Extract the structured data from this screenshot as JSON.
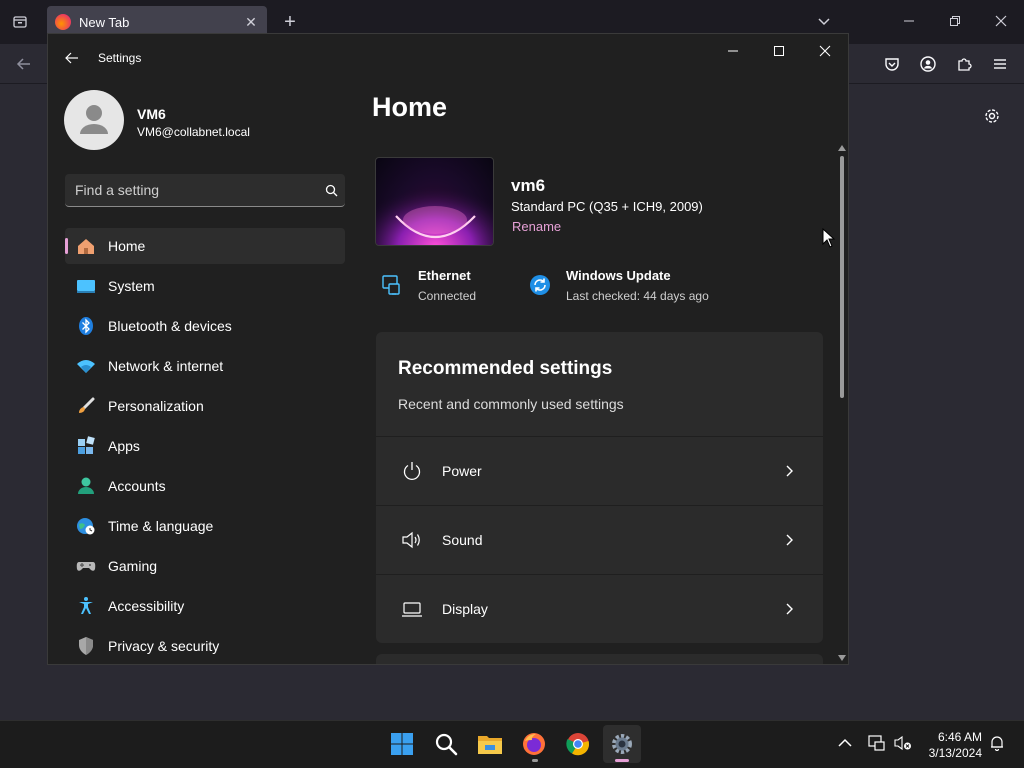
{
  "browser": {
    "tab_title": "New Tab",
    "new_tab_symbol": "+"
  },
  "settings": {
    "window_title": "Settings",
    "profile": {
      "name": "VM6",
      "email": "VM6@collabnet.local"
    },
    "search_placeholder": "Find a setting",
    "nav": [
      {
        "label": "Home",
        "icon": "home-icon",
        "active": true
      },
      {
        "label": "System",
        "icon": "system-icon"
      },
      {
        "label": "Bluetooth & devices",
        "icon": "bluetooth-icon"
      },
      {
        "label": "Network & internet",
        "icon": "wifi-icon"
      },
      {
        "label": "Personalization",
        "icon": "brush-icon"
      },
      {
        "label": "Apps",
        "icon": "apps-icon"
      },
      {
        "label": "Accounts",
        "icon": "account-icon"
      },
      {
        "label": "Time & language",
        "icon": "globe-clock-icon"
      },
      {
        "label": "Gaming",
        "icon": "gamepad-icon"
      },
      {
        "label": "Accessibility",
        "icon": "accessibility-icon"
      },
      {
        "label": "Privacy & security",
        "icon": "shield-icon"
      }
    ],
    "page_title": "Home",
    "device": {
      "name": "vm6",
      "model": "Standard PC (Q35 + ICH9, 2009)",
      "rename_label": "Rename"
    },
    "status": [
      {
        "title": "Ethernet",
        "subtitle": "Connected",
        "icon": "ethernet-icon"
      },
      {
        "title": "Windows Update",
        "subtitle": "Last checked: 44 days ago",
        "icon": "windows-update-icon"
      }
    ],
    "recommended": {
      "title": "Recommended settings",
      "subtitle": "Recent and commonly used settings",
      "items": [
        {
          "label": "Power",
          "icon": "power-icon"
        },
        {
          "label": "Sound",
          "icon": "speaker-icon"
        },
        {
          "label": "Display",
          "icon": "display-icon"
        }
      ]
    }
  },
  "taskbar": {
    "time": "6:46 AM",
    "date": "3/13/2024",
    "apps": [
      "start-icon",
      "search-icon",
      "file-explorer-icon",
      "firefox-icon",
      "chrome-icon",
      "settings-icon"
    ]
  },
  "colors": {
    "accent": "#e6a0d6",
    "window_bg": "#202020",
    "card_bg": "#2b2b2b"
  }
}
